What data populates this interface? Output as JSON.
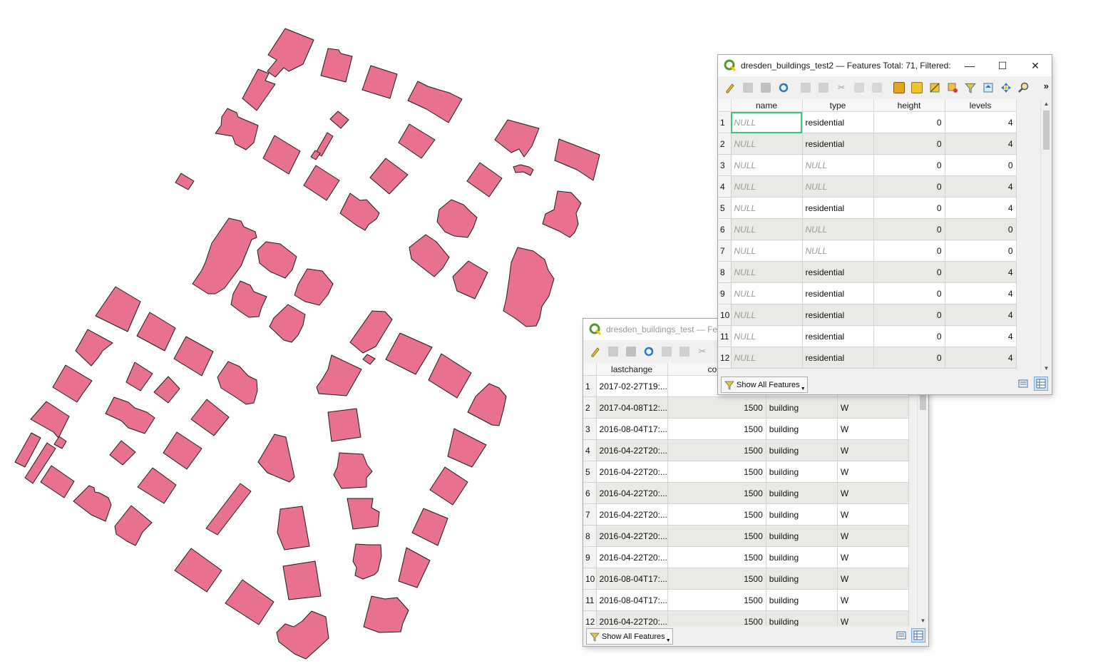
{
  "colors": {
    "building_fill": "#e8718d",
    "building_stroke": "#1e1e1e",
    "selected_cell": "#3ec77a"
  },
  "window1": {
    "title": "dresden_buildings_test — Fea",
    "columns": [
      "lastchange",
      "co",
      "",
      ""
    ],
    "rows": [
      {
        "n": "1",
        "lastchange": "2017-02-27T19:...",
        "co": "",
        "kind": "",
        "w": ""
      },
      {
        "n": "2",
        "lastchange": "2017-04-08T12:...",
        "co": "1500",
        "kind": "building",
        "w": "W"
      },
      {
        "n": "3",
        "lastchange": "2016-08-04T17:...",
        "co": "1500",
        "kind": "building",
        "w": "W"
      },
      {
        "n": "4",
        "lastchange": "2016-04-22T20:...",
        "co": "1500",
        "kind": "building",
        "w": "W"
      },
      {
        "n": "5",
        "lastchange": "2016-04-22T20:...",
        "co": "1500",
        "kind": "building",
        "w": "W"
      },
      {
        "n": "6",
        "lastchange": "2016-04-22T20:...",
        "co": "1500",
        "kind": "building",
        "w": "W"
      },
      {
        "n": "7",
        "lastchange": "2016-04-22T20:...",
        "co": "1500",
        "kind": "building",
        "w": "W"
      },
      {
        "n": "8",
        "lastchange": "2016-04-22T20:...",
        "co": "1500",
        "kind": "building",
        "w": "W"
      },
      {
        "n": "9",
        "lastchange": "2016-04-22T20:...",
        "co": "1500",
        "kind": "building",
        "w": "W"
      },
      {
        "n": "10",
        "lastchange": "2016-08-04T17:...",
        "co": "1500",
        "kind": "building",
        "w": "W"
      },
      {
        "n": "11",
        "lastchange": "2016-08-04T17:...",
        "co": "1500",
        "kind": "building",
        "w": "W"
      },
      {
        "n": "12",
        "lastchange": "2016-04-22T20:...",
        "co": "1500",
        "kind": "building",
        "w": "W"
      }
    ],
    "filter_label": "Show All Features"
  },
  "window2": {
    "title": "dresden_buildings_test2 — Features Total: 71, Filtered: ...",
    "minimize": "—",
    "maximize": "☐",
    "close": "✕",
    "more": "»",
    "columns": [
      "name",
      "type",
      "height",
      "levels"
    ],
    "rows": [
      {
        "n": "1",
        "name": "NULL",
        "type": "residential",
        "height": "0",
        "levels": "4"
      },
      {
        "n": "2",
        "name": "NULL",
        "type": "residential",
        "height": "0",
        "levels": "4"
      },
      {
        "n": "3",
        "name": "NULL",
        "type": "NULL",
        "height": "0",
        "levels": "0"
      },
      {
        "n": "4",
        "name": "NULL",
        "type": "NULL",
        "height": "0",
        "levels": "4"
      },
      {
        "n": "5",
        "name": "NULL",
        "type": "residential",
        "height": "0",
        "levels": "4"
      },
      {
        "n": "6",
        "name": "NULL",
        "type": "NULL",
        "height": "0",
        "levels": "0"
      },
      {
        "n": "7",
        "name": "NULL",
        "type": "NULL",
        "height": "0",
        "levels": "0"
      },
      {
        "n": "8",
        "name": "NULL",
        "type": "residential",
        "height": "0",
        "levels": "4"
      },
      {
        "n": "9",
        "name": "NULL",
        "type": "residential",
        "height": "0",
        "levels": "4"
      },
      {
        "n": "10",
        "name": "NULL",
        "type": "residential",
        "height": "0",
        "levels": "4"
      },
      {
        "n": "11",
        "name": "NULL",
        "type": "residential",
        "height": "0",
        "levels": "4"
      },
      {
        "n": "12",
        "name": "NULL",
        "type": "residential",
        "height": "0",
        "levels": "4"
      }
    ],
    "filter_label": "Show All Features"
  },
  "toolbar_icons": [
    "toggle-editing-icon",
    "multi-edit-icon",
    "save-edits-icon",
    "reload-icon",
    "add-feature-icon",
    "delete-feature-icon",
    "cut-icon",
    "copy-icon",
    "paste-icon",
    "field-calculator-icon",
    "select-all-icon",
    "invert-selection-icon",
    "deselect-icon",
    "select-by-expression-icon",
    "move-selection-top-icon",
    "pan-to-selection-icon",
    "zoom-to-selection-icon"
  ]
}
